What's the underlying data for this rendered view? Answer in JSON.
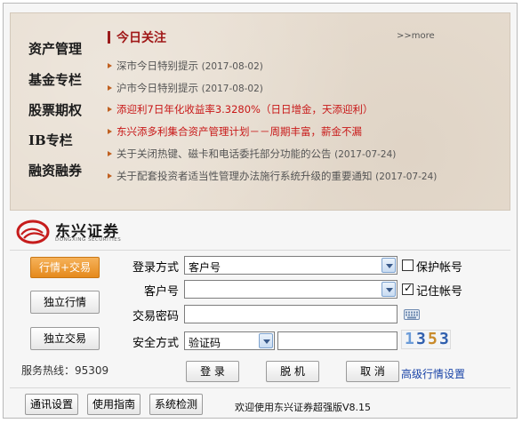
{
  "left_menu": [
    "资产管理",
    "基金专栏",
    "股票期权",
    "IB专栏",
    "融资融券"
  ],
  "today": {
    "title": "今日关注",
    "more": ">>more"
  },
  "news": [
    {
      "title": "深市今日特别提示",
      "date": "(2017-08-02)",
      "style": "gray"
    },
    {
      "title": "沪市今日特别提示",
      "date": "(2017-08-02)",
      "style": "gray"
    },
    {
      "title": "添迎利7日年化收益率3.3280%（日日增金，天添迎利）",
      "date": "",
      "style": "red"
    },
    {
      "title": "东兴添多利集合资产管理计划－－周期丰富，薪金不漏",
      "date": "",
      "style": "red"
    },
    {
      "title": "关于关闭热键、磁卡和电话委托部分功能的公告",
      "date": "(2017-07-24)",
      "style": "gray"
    },
    {
      "title": "关于配套投资者适当性管理办法施行系统升级的重要通知",
      "date": "(2017-07-24)",
      "style": "gray"
    }
  ],
  "logo": {
    "cn": "东兴证券",
    "en": "DONGXING SECURITIES"
  },
  "side_buttons": {
    "trade_quote": "行情+交易",
    "quote_only": "独立行情",
    "trade_only": "独立交易"
  },
  "hotline": "服务热线：95309",
  "form": {
    "login_mode_label": "登录方式",
    "login_mode_value": "客户号",
    "protect_account_label": "保护帐号",
    "protect_account_checked": false,
    "customer_no_label": "客户号",
    "customer_no_value": "",
    "remember_account_label": "记住帐号",
    "remember_account_checked": true,
    "trade_password_label": "交易密码",
    "trade_password_value": "",
    "security_mode_label": "安全方式",
    "security_mode_value": "验证码",
    "verify_code_value": "",
    "captcha_digits": [
      "1",
      "3",
      "5",
      "3"
    ]
  },
  "actions": {
    "login": "登 录",
    "offline": "脱 机",
    "cancel": "取 消",
    "advanced_quote": "高级行情设置"
  },
  "footer": {
    "comm_settings": "通讯设置",
    "guide": "使用指南",
    "sys_check": "系统检测",
    "welcome": "欢迎使用东兴证券超强版V8.15"
  },
  "colors": {
    "accent_red": "#a01818",
    "news_red": "#c81818",
    "orange_button": "#e58a1c",
    "link_blue": "#1a44a8"
  }
}
